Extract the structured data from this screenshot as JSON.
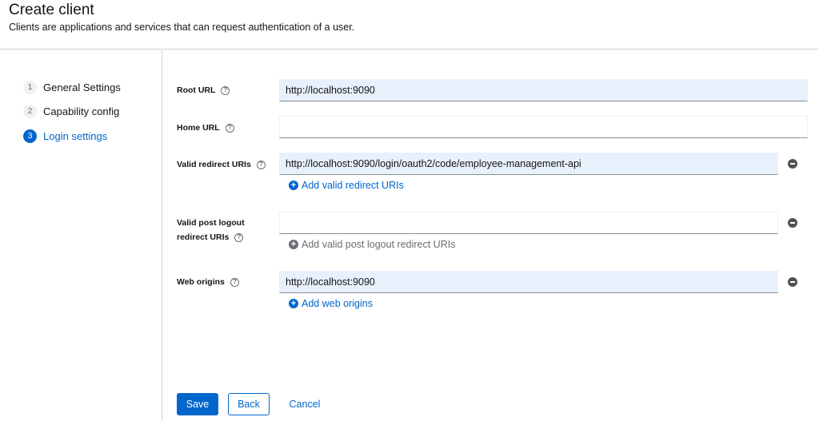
{
  "header": {
    "title": "Create client",
    "subtitle": "Clients are applications and services that can request authentication of a user."
  },
  "wizard": {
    "steps": [
      {
        "number": "1",
        "label": "General Settings",
        "active": false
      },
      {
        "number": "2",
        "label": "Capability config",
        "active": false
      },
      {
        "number": "3",
        "label": "Login settings",
        "active": true
      }
    ]
  },
  "form": {
    "root_url": {
      "label": "Root URL",
      "value": "http://localhost:9090"
    },
    "home_url": {
      "label": "Home URL",
      "value": ""
    },
    "valid_redirect_uris": {
      "label": "Valid redirect URIs",
      "values": [
        "http://localhost:9090/login/oauth2/code/employee-management-api"
      ],
      "add_label": "Add valid redirect URIs"
    },
    "valid_post_logout_redirect_uris": {
      "label_line1": "Valid post logout",
      "label_line2": "redirect URIs",
      "values": [
        ""
      ],
      "add_label": "Add valid post logout redirect URIs"
    },
    "web_origins": {
      "label": "Web origins",
      "values": [
        "http://localhost:9090"
      ],
      "add_label": "Add web origins"
    }
  },
  "actions": {
    "save_label": "Save",
    "back_label": "Back",
    "cancel_label": "Cancel"
  },
  "icons": {
    "help": "?",
    "plus": "+"
  },
  "colors": {
    "primary": "#0066cc",
    "filled_input_bg": "#e8f0fb",
    "border": "#d2d2d2",
    "muted": "#6a6e73"
  }
}
